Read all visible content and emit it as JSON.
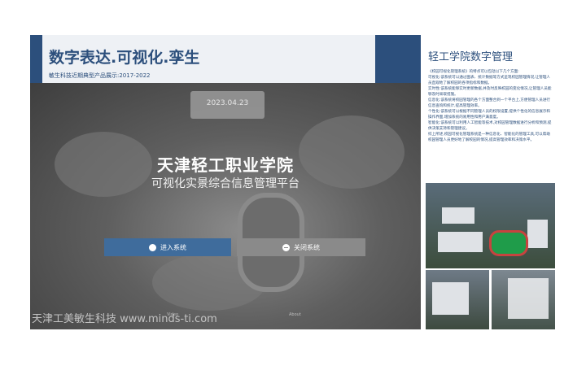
{
  "header": {
    "title": "数字表达.可视化.孪生",
    "subtitle": "敏生科技近期典型产品展示:2017-2022"
  },
  "screen": {
    "date": "2023.04.23",
    "school_name": "天津轻工职业学院",
    "platform_name": "可视化实景综合信息管理平台",
    "enter_button": "进入系统",
    "close_button": "关闭系统",
    "watermark": "天津工美敏生科技 www.minds-ti.com",
    "footer_links": [
      "Video",
      "About"
    ]
  },
  "side": {
    "title": "轻工学院数字管理",
    "paragraphs": [
      "《校园可视化管理系统》的特点可以包括以下几个方面:",
      "可视化:该系统可以通过图表、统计数据等方式呈现校园管理情况,让管理人员直观地了解校园的各项指标和数据。",
      "实时性:该系统能够实时更新数据,并及时反映校园的变化情况,让管理人员能够及时采取措施。",
      "信息化:该系统将校园管理的各个方面整合到一个平台上,方便管理人员进行信息查询和统计,提高管理效率。",
      "个性化:该系统可以根据不同管理人员的权限设置,提供个性化的信息展示和操作界面,增加系统的易用性和用户满意度。",
      "智能化:该系统可以利用人工智能等技术,对校园管理数据进行分析和预测,提供决策支持和管理建议。",
      "综上所述,校园可视化管理系统是一种信息化、智能化的管理工具,可以帮助校园管理人员更好地了解校园的情况,提高管理效率和决策水平。"
    ]
  },
  "colors": {
    "brand": "#2c4f7c",
    "enter_button": "#3f6c9c",
    "close_button": "#8a8a8a"
  }
}
